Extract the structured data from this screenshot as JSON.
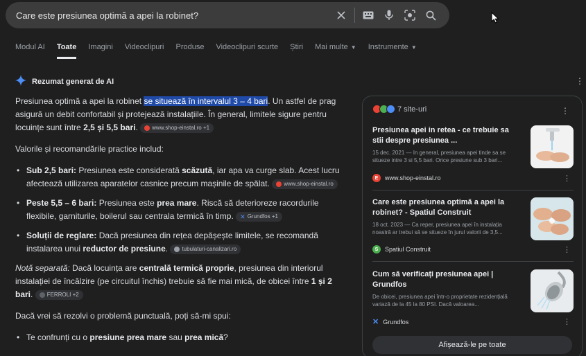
{
  "search": {
    "query": "Care este presiunea optimă a apei la robinet?",
    "icons": [
      "close-icon",
      "keyboard-icon",
      "mic-icon",
      "lens-icon",
      "search-icon"
    ]
  },
  "tabs": [
    "Modul AI",
    "Toate",
    "Imagini",
    "Videoclipuri",
    "Produse",
    "Videoclipuri scurte",
    "Știri",
    "Mai multe",
    "Instrumente"
  ],
  "active_tab": "Toate",
  "ai_overview": {
    "heading": "Rezumat generat de AI",
    "p1_a": "Presiunea optimă a apei la robinet ",
    "p1_hl": "se situează în intervalul 3 – 4 bari",
    "p1_b": ". Un astfel de prag asigură un debit confortabil și protejează instalațiile. În general, limitele sigure pentru locuințe sunt între ",
    "p1_bold": "2,5 și 5,5 bari",
    "p1_c": ".",
    "p1_chip": "www.shop-einstal.ro +1",
    "p2": "Valorile și recomandările practice includ:",
    "li1_bold": "Sub 2,5 bari:",
    "li1_a": " Presiunea este considerată ",
    "li1_bold2": "scăzută",
    "li1_b": ", iar apa va curge slab. Acest lucru afectează utilizarea aparatelor casnice precum mașinile de spălat.",
    "li1_chip": "www.shop-einstal.ro",
    "li2_bold": "Peste 5,5 – 6 bari:",
    "li2_a": " Presiunea este ",
    "li2_bold2": "prea mare",
    "li2_b": ". Riscă să deterioreze racordurile flexibile, garniturile, boilerul sau centrala termică în timp.",
    "li2_chip": "Grundfos +1",
    "li3_bold": "Soluții de reglare:",
    "li3_a": " Dacă presiunea din rețea depășește limitele, se recomandă instalarea unui ",
    "li3_bold2": "reductor de presiune",
    "li3_b": ".",
    "li3_chip": "tubulaturi-canalizari.ro",
    "p3_italic": "Notă separată:",
    "p3_a": " Dacă locuința are ",
    "p3_bold": "centrală termică proprie",
    "p3_b": ", presiunea din interiorul instalației de încălzire (pe circuitul închis) trebuie să fie mai mică, de obicei între ",
    "p3_bold2": "1 și 2 bari",
    "p3_c": ".",
    "p3_chip": "FERROLI +2",
    "p4": "Dacă vrei să rezolvi o problemă punctuală, poți să-mi spui:",
    "li4_a": "Te confrunți cu o ",
    "li4_bold": "presiune prea mare",
    "li4_b": " sau ",
    "li4_bold2": "prea mică",
    "li4_c": "?"
  },
  "sources": {
    "count_label": "7 site-uri",
    "items": [
      {
        "title": "Presiunea apei in retea - ce trebuie sa stii despre presiunea ...",
        "snippet": "15 dec. 2021 — In general, presiunea apei tinde sa se situeze intre 3 si 5,5 bari. Orice presiune sub 3 bari...",
        "site": "www.shop-einstal.ro",
        "thumb": "hands-faucet"
      },
      {
        "title": "Care este presiunea optimă a apei la robinet? - Spatiul Construit",
        "snippet": "18 oct. 2023 — Ca reper, presiunea apei în instalația noastră ar trebui să se situeze în jurul valorii de 3,5...",
        "site": "Spatiul Construit",
        "thumb": "washing-hands"
      },
      {
        "title": "Cum să verificați presiunea apei | Grundfos",
        "snippet": "De obicei, presiunea apei într-o proprietate rezidențială variază de la 45 la 80 PSI. Dacă valoarea...",
        "site": "Grundfos",
        "thumb": "shower-head"
      }
    ],
    "show_all": "Afișează-le pe toate"
  },
  "colors": {
    "highlight": "#1f4aa8",
    "ai_star": "#4c8df6",
    "einstal": "#ea4335"
  }
}
